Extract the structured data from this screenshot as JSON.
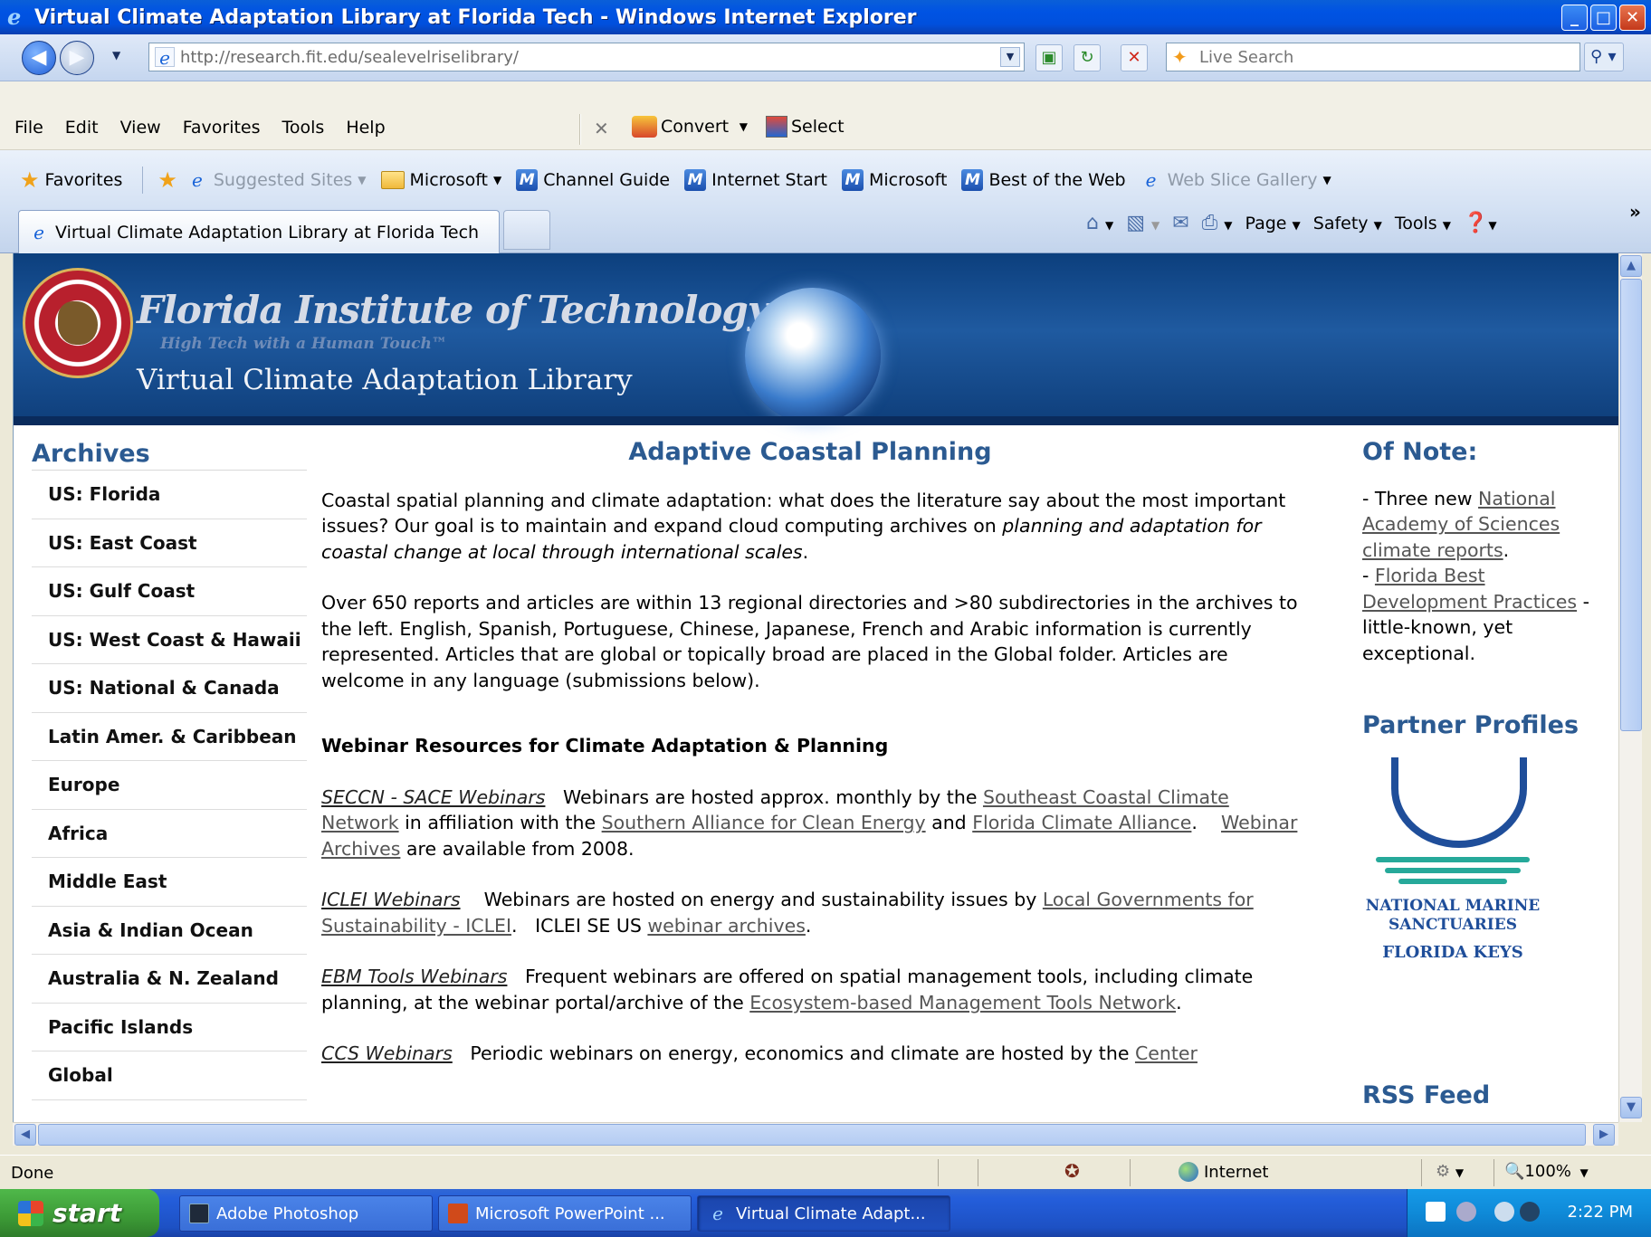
{
  "window": {
    "title": "Virtual Climate Adaptation Library at Florida Tech - Windows Internet Explorer",
    "minimize": "_",
    "maximize": "□",
    "close": "✕"
  },
  "address": {
    "url": "http://research.fit.edu/sealevelriselibrary/",
    "search_placeholder": "Live Search"
  },
  "menu": [
    "File",
    "Edit",
    "View",
    "Favorites",
    "Tools",
    "Help"
  ],
  "toolbar": {
    "convert": "Convert",
    "select": "Select",
    "close_x": "✕"
  },
  "favorites": {
    "label": "Favorites",
    "items": [
      "Suggested Sites",
      "Microsoft",
      "Channel Guide",
      "Internet Start",
      "Microsoft",
      "Best of the Web",
      "Web Slice Gallery"
    ]
  },
  "tab": {
    "label": "Virtual Climate Adaptation Library at Florida Tech"
  },
  "commandbar": {
    "page": "Page",
    "safety": "Safety",
    "tools": "Tools"
  },
  "banner": {
    "institution": "Florida Institute of Technology",
    "tagline": "High Tech with a Human Touch™",
    "library": "Virtual Climate Adaptation Library"
  },
  "archives": {
    "heading": "Archives",
    "items": [
      "US: Florida",
      "US: East Coast",
      "US: Gulf Coast",
      "US: West Coast & Hawaii",
      "US: National & Canada",
      "Latin Amer. & Caribbean",
      "Europe",
      "Africa",
      "Middle East",
      "Asia & Indian Ocean",
      "Australia & N. Zealand",
      "Pacific Islands",
      "Global"
    ]
  },
  "main": {
    "heading": "Adaptive Coastal Planning",
    "intro_a": "Coastal spatial planning and climate adaptation:  what does the literature say about the most important issues?  Our goal is to maintain and expand cloud computing archives on ",
    "intro_em": "planning and adaptation for coastal change at local through international scales",
    "intro_b": ".",
    "para2": "Over 650 reports and articles are within 13 regional directories and >80 subdirectories in the archives to the left.  English, Spanish, Portuguese, Chinese, Japanese, French and Arabic information is currently represented.  Articles that are global or topically broad are placed in the Global folder.  Articles are welcome in any language (submissions below).",
    "webinar_heading": "Webinar Resources for Climate Adaptation & Planning",
    "seccn": {
      "title": "SECCN - SACE Webinars",
      "t1": "   Webinars are hosted approx. monthly by the ",
      "l1": "Southeast Coastal Climate Network",
      "t2": " in affiliation with the ",
      "l2": "Southern Alliance for Clean Energy",
      "t3": " and ",
      "l3": "Florida Climate Alliance",
      "t4": ".    ",
      "l4": "Webinar Archives",
      "t5": " are available from 2008."
    },
    "iclei": {
      "title": "ICLEI Webinars",
      "t1": "    Webinars are hosted on energy and sustainability issues by ",
      "l1": "Local Governments for Sustainability - ICLEI",
      "t2": ".   ICLEI SE US ",
      "l2": "webinar archives",
      "t3": "."
    },
    "ebm": {
      "title": "EBM Tools Webinars",
      "t1": "   Frequent webinars are offered on spatial management tools, including climate planning, at the webinar portal/archive of the ",
      "l1": "Ecosystem-based Management Tools Network",
      "t2": "."
    },
    "ccs": {
      "title": "CCS Webinars",
      "t1": "   Periodic webinars on energy, economics and climate are hosted by the ",
      "l1": "Center"
    }
  },
  "of_note": {
    "heading": "Of Note:",
    "t1": "- Three new ",
    "l1": "National Academy of Sciences climate reports",
    "t2": ".",
    "t3": "- ",
    "l2": "Florida Best Development Practices",
    "t4": " - little-known, yet exceptional."
  },
  "partner": {
    "heading": "Partner Profiles",
    "logo_line1": "NATIONAL MARINE",
    "logo_line2": "SANCTUARIES",
    "logo_line3": "FLORIDA KEYS",
    "next_heading": "RSS Feed"
  },
  "status": {
    "text": "Done",
    "zone": "Internet",
    "zoom": "100%"
  },
  "taskbar": {
    "start": "start",
    "tasks": [
      "Adobe Photoshop",
      "Microsoft PowerPoint ...",
      "Virtual Climate Adapt..."
    ],
    "clock": "2:22 PM"
  }
}
